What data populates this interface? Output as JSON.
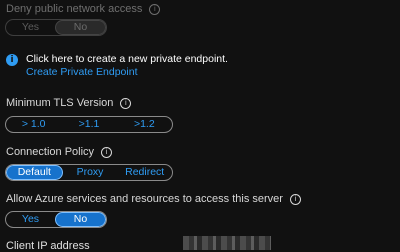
{
  "deny_public": {
    "label": "Deny public network access",
    "options": [
      "Yes",
      "No"
    ],
    "selected": "No"
  },
  "endpoint_banner": {
    "message": "Click here to create a new private endpoint.",
    "link": "Create Private Endpoint"
  },
  "tls": {
    "label": "Minimum TLS Version",
    "options": [
      "> 1.0",
      ">1.1",
      ">1.2"
    ]
  },
  "connection_policy": {
    "label": "Connection Policy",
    "options": [
      "Default",
      "Proxy",
      "Redirect"
    ],
    "selected": "Default"
  },
  "allow_azure": {
    "label": "Allow Azure services and resources to access this server",
    "options": [
      "Yes",
      "No"
    ],
    "selected": "No"
  },
  "client_ip": {
    "label": "Client IP address"
  },
  "colors": {
    "accent": "#2f9cf3",
    "selected_bg": "#1672cc",
    "background": "#111111"
  }
}
